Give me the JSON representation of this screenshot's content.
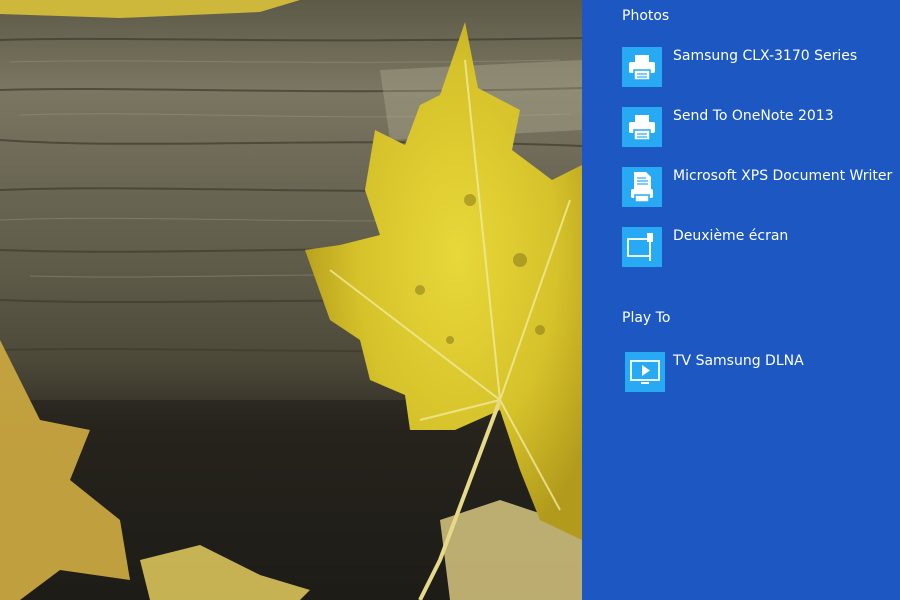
{
  "panel": {
    "background": "#1d58c2",
    "tile_color": "#27a9f3",
    "sections": [
      {
        "title": "Photos",
        "devices": [
          {
            "label": "Samsung CLX-3170 Series",
            "icon": "printer-icon"
          },
          {
            "label": "Send To OneNote 2013",
            "icon": "printer-icon"
          },
          {
            "label": "Microsoft XPS Document Writer",
            "icon": "document-printer-icon"
          },
          {
            "label": "Deuxième écran",
            "icon": "second-screen-icon"
          }
        ]
      },
      {
        "title": "Play To",
        "devices": [
          {
            "label": "TV Samsung DLNA",
            "icon": "play-to-monitor-icon"
          }
        ]
      }
    ]
  }
}
